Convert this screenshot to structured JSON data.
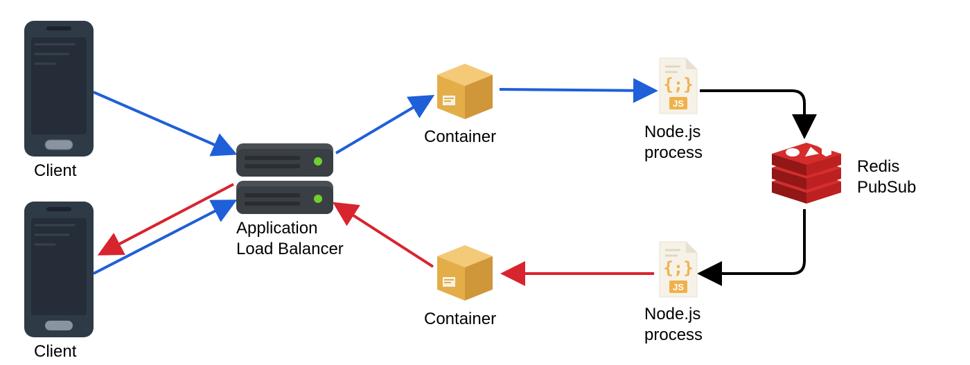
{
  "labels": {
    "client_top": "Client",
    "client_bottom": "Client",
    "alb_line1": "Application",
    "alb_line2": "Load Balancer",
    "container_top": "Container",
    "container_bottom": "Container",
    "nodejs_top_line1": "Node.js",
    "nodejs_top_line2": "process",
    "nodejs_bottom_line1": "Node.js",
    "nodejs_bottom_line2": "process",
    "redis_line1": "Redis",
    "redis_line2": "PubSub"
  },
  "icons": {
    "phone": "phone",
    "server": "server-stack",
    "box": "package-box",
    "jsfile": "javascript-file",
    "redis": "redis"
  },
  "colors": {
    "blue_arrow": "#1f5fd8",
    "red_arrow": "#d8242e",
    "black_arrow": "#000000",
    "phone_body": "#2f3a47",
    "phone_body_dark": "#242d38",
    "server_body": "#3a3f45",
    "server_body_light": "#4a4f55",
    "server_led": "#6fcf2e",
    "box_light": "#f4c978",
    "box_dark": "#e3ae47",
    "box_shadow": "#cf963a",
    "file_paper": "#f6f2e8",
    "file_fold": "#e9e1cf",
    "file_lines": "#e0d8c5",
    "js_orange": "#f0b14c",
    "redis_red": "#bd2020",
    "redis_red_dark": "#921717",
    "redis_red_light": "#d52c2c",
    "redis_white": "#ffffff"
  },
  "arrows": [
    {
      "id": "client1_to_alb",
      "color": "blue_arrow"
    },
    {
      "id": "client2_to_alb",
      "color": "blue_arrow"
    },
    {
      "id": "alb_to_container_top",
      "color": "blue_arrow"
    },
    {
      "id": "container_top_to_node_top",
      "color": "blue_arrow"
    },
    {
      "id": "node_top_to_redis",
      "color": "black_arrow"
    },
    {
      "id": "redis_to_node_bottom",
      "color": "black_arrow"
    },
    {
      "id": "node_bottom_to_container_bottom",
      "color": "red_arrow"
    },
    {
      "id": "container_bottom_to_alb",
      "color": "red_arrow"
    },
    {
      "id": "alb_to_client_bottom",
      "color": "red_arrow"
    }
  ]
}
